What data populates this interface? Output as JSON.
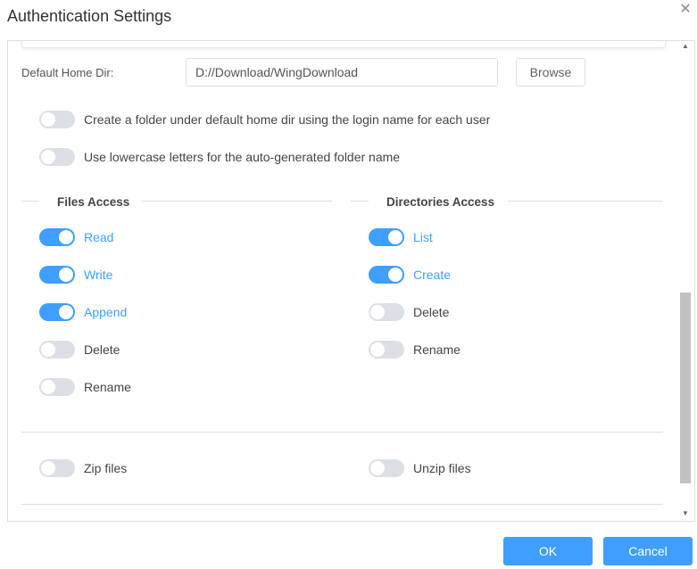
{
  "window": {
    "title": "Authentication Settings",
    "close_glyph": "✕"
  },
  "home_dir": {
    "label": "Default Home Dir:",
    "value": "D://Download/WingDownload",
    "browse_label": "Browse"
  },
  "options": [
    {
      "label": "Create a folder under default home dir using the login name for each user",
      "on": false
    },
    {
      "label": "Use lowercase letters for the auto-generated folder name",
      "on": false
    }
  ],
  "files_access": {
    "title": "Files Access",
    "items": [
      {
        "label": "Read",
        "on": true
      },
      {
        "label": "Write",
        "on": true
      },
      {
        "label": "Append",
        "on": true
      },
      {
        "label": "Delete",
        "on": false
      },
      {
        "label": "Rename",
        "on": false
      }
    ]
  },
  "directories_access": {
    "title": "Directories Access",
    "items": [
      {
        "label": "List",
        "on": true
      },
      {
        "label": "Create",
        "on": true
      },
      {
        "label": "Delete",
        "on": false
      },
      {
        "label": "Rename",
        "on": false
      }
    ]
  },
  "archive": [
    {
      "label": "Zip files",
      "on": false
    },
    {
      "label": "Unzip files",
      "on": false
    }
  ],
  "scrollbar": {
    "up_glyph": "▲",
    "down_glyph": "▼"
  },
  "footer": {
    "ok_label": "OK",
    "cancel_label": "Cancel"
  },
  "colors": {
    "accent": "#409eff",
    "toggle_off": "#dcdfe6"
  }
}
